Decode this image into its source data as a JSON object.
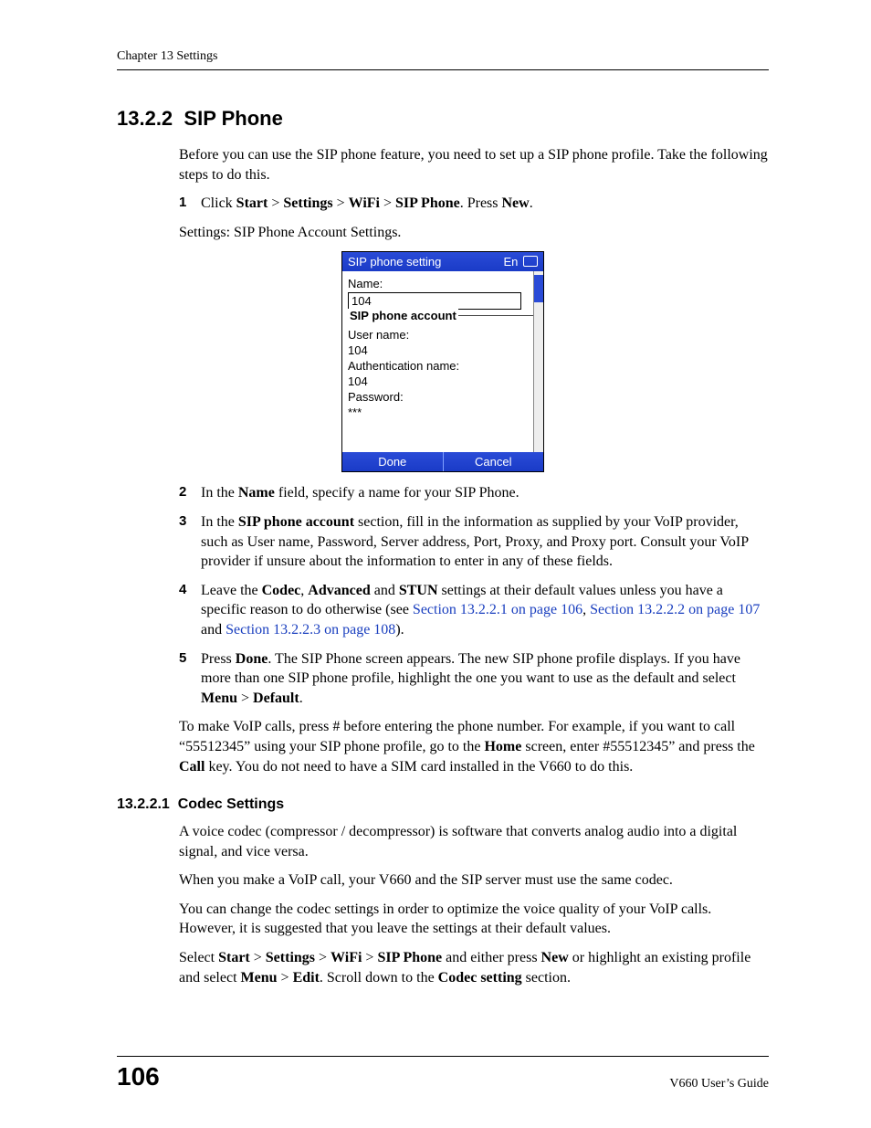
{
  "header": {
    "chapter": "Chapter 13 Settings"
  },
  "section": {
    "number": "13.2.2",
    "title": "SIP Phone"
  },
  "intro": "Before you can use the SIP phone feature, you need to set up a SIP phone profile. Take the following steps to do this.",
  "steps": {
    "s1": {
      "num": "1",
      "pre": "Click ",
      "b1": "Start",
      "sep1": " > ",
      "b2": "Settings",
      "sep2": " > ",
      "b3": "WiFi",
      "sep3": " > ",
      "b4": "SIP Phone",
      "mid": ". Press ",
      "b5": "New",
      "post": "."
    },
    "s2": {
      "num": "2",
      "pre": "In the ",
      "b1": "Name",
      "post": " field, specify a name for your SIP Phone."
    },
    "s3": {
      "num": "3",
      "pre": "In the ",
      "b1": "SIP phone account",
      "post": " section, fill in the information as supplied by your VoIP provider, such as User name, Password, Server address, Port, Proxy, and Proxy port. Consult your VoIP provider if unsure about the information to enter in any of these fields."
    },
    "s4": {
      "num": "4",
      "pre": "Leave the ",
      "b1": "Codec",
      "sep1": ", ",
      "b2": "Advanced",
      "sep2": " and ",
      "b3": "STUN",
      "mid": " settings at their default values unless you have a specific reason to do otherwise (see ",
      "l1": "Section 13.2.2.1 on page 106",
      "sep3": ", ",
      "l2": "Section 13.2.2.2 on page 107",
      "sep4": " and ",
      "l3": "Section 13.2.2.3 on page 108",
      "post": ")."
    },
    "s5": {
      "num": "5",
      "pre": "Press ",
      "b1": "Done",
      "mid": ". The SIP Phone screen appears. The new SIP phone profile displays. If you have more than one SIP phone profile, highlight the one you want to use as the default and select ",
      "b2": "Menu",
      "sep": " > ",
      "b3": "Default",
      "post": "."
    }
  },
  "figure_caption": "Settings: SIP Phone Account Settings.",
  "phone": {
    "title": "SIP phone setting",
    "lang": "En",
    "name_label": "Name:",
    "name_value": "104",
    "account_legend": "SIP phone account",
    "user_label": "User name:",
    "user_value": "104",
    "auth_label": "Authentication name:",
    "auth_value": "104",
    "pass_label": "Password:",
    "pass_value": "***",
    "done": "Done",
    "cancel": "Cancel"
  },
  "closing": {
    "pre": "To make VoIP calls, press # before entering the phone number. For example, if you want to call “55512345” using your SIP phone profile, go to the ",
    "b1": "Home",
    "mid": " screen, enter #55512345” and press the ",
    "b2": "Call",
    "post": " key. You do not need to have a SIM card installed in the V660 to do this."
  },
  "subsection": {
    "number": "13.2.2.1",
    "title": "Codec Settings"
  },
  "codec": {
    "p1": "A voice codec (compressor / decompressor) is software that converts analog audio into a digital signal, and vice versa.",
    "p2": "When you make a VoIP call, your V660 and the SIP server must use the same codec.",
    "p3": "You can change the codec settings in order to optimize the voice quality of your VoIP calls. However, it is suggested that you leave the settings at their default values.",
    "p4": {
      "pre": "Select ",
      "b1": "Start",
      "s1": " > ",
      "b2": "Settings",
      "s2": " > ",
      "b3": "WiFi",
      "s3": " > ",
      "b4": "SIP Phone",
      "mid1": " and either press ",
      "b5": "New",
      "mid2": " or highlight an existing profile and select ",
      "b6": "Menu",
      "s4": " > ",
      "b7": "Edit",
      "mid3": ". Scroll down to the ",
      "b8": "Codec setting",
      "post": " section."
    }
  },
  "footer": {
    "page": "106",
    "guide": "V660 User’s Guide"
  }
}
